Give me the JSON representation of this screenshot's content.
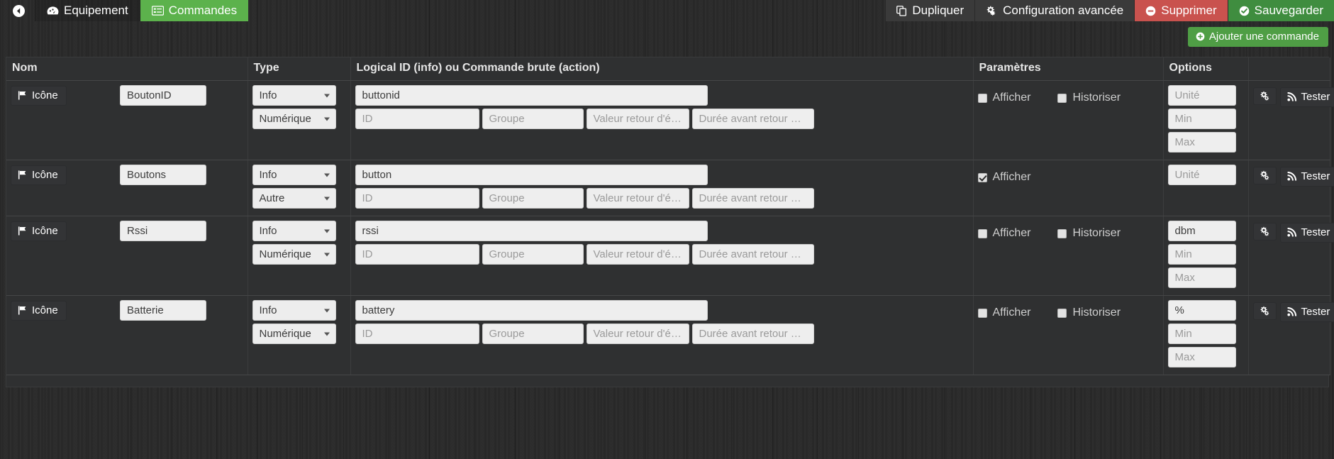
{
  "topbar": {
    "back_label": "",
    "back_icon": "circle-arrow-left-icon",
    "tabs": [
      {
        "label": "Equipement",
        "icon": "dashboard-icon",
        "active": false
      },
      {
        "label": "Commandes",
        "icon": "list-alt-icon",
        "active": true
      }
    ],
    "buttons": [
      {
        "label": "Dupliquer",
        "icon": "copy-icon",
        "style": "default"
      },
      {
        "label": "Configuration avancée",
        "icon": "gears-icon",
        "style": "default"
      },
      {
        "label": "Supprimer",
        "icon": "minus-circle-icon",
        "style": "danger"
      },
      {
        "label": "Sauvegarder",
        "icon": "check-circle-icon",
        "style": "success"
      }
    ]
  },
  "add_command": {
    "label": "Ajouter une commande",
    "icon": "plus-circle-icon"
  },
  "table": {
    "headers": {
      "nom": "Nom",
      "type": "Type",
      "logical_id": "Logical ID (info) ou Commande brute (action)",
      "parametres": "Paramètres",
      "options": "Options",
      "actions": ""
    },
    "placeholders": {
      "id": "ID",
      "groupe": "Groupe",
      "valeur_retour": "Valeur retour d'état",
      "duree_retour": "Durée avant retour d'ét",
      "unite": "Unité",
      "min": "Min",
      "max": "Max"
    },
    "labels": {
      "icone": "Icône",
      "afficher": "Afficher",
      "historiser": "Historiser",
      "tester": "Tester"
    },
    "icons": {
      "icone": "flag-icon",
      "config": "gears-icon",
      "tester": "rss-icon",
      "remove": "minus-circle-icon"
    },
    "rows": [
      {
        "name": "BoutonID",
        "type": "Info",
        "subtype": "Numérique",
        "logical_id": "buttonid",
        "sub_id": "",
        "sub_groupe": "",
        "sub_valeur": "",
        "sub_duree": "",
        "afficher": {
          "label": "Afficher",
          "checked": false,
          "visible": true
        },
        "historiser": {
          "label": "Historiser",
          "checked": false,
          "visible": true
        },
        "unite": "",
        "min": "",
        "max": "",
        "show_minmax": true,
        "tester": "Tester"
      },
      {
        "name": "Boutons",
        "type": "Info",
        "subtype": "Autre",
        "logical_id": "button",
        "sub_id": "",
        "sub_groupe": "",
        "sub_valeur": "",
        "sub_duree": "",
        "afficher": {
          "label": "Afficher",
          "checked": true,
          "visible": true
        },
        "historiser": {
          "label": "Historiser",
          "checked": false,
          "visible": false
        },
        "unite": "",
        "min": "",
        "max": "",
        "show_minmax": false,
        "tester": "Tester"
      },
      {
        "name": "Rssi",
        "type": "Info",
        "subtype": "Numérique",
        "logical_id": "rssi",
        "sub_id": "",
        "sub_groupe": "",
        "sub_valeur": "",
        "sub_duree": "",
        "afficher": {
          "label": "Afficher",
          "checked": false,
          "visible": true
        },
        "historiser": {
          "label": "Historiser",
          "checked": false,
          "visible": true
        },
        "unite": "dbm",
        "min": "",
        "max": "",
        "show_minmax": true,
        "tester": "Tester"
      },
      {
        "name": "Batterie",
        "type": "Info",
        "subtype": "Numérique",
        "logical_id": "battery",
        "sub_id": "",
        "sub_groupe": "",
        "sub_valeur": "",
        "sub_duree": "",
        "afficher": {
          "label": "Afficher",
          "checked": false,
          "visible": true
        },
        "historiser": {
          "label": "Historiser",
          "checked": false,
          "visible": true
        },
        "unite": "%",
        "min": "",
        "max": "",
        "show_minmax": true,
        "tester": "Tester"
      }
    ]
  },
  "colors": {
    "accent_green": "#5cb24c",
    "danger_red": "#c9524e",
    "save_green": "#3f8d3f",
    "panel_bg": "#2f3031",
    "page_bg": "#2b2b2b"
  }
}
